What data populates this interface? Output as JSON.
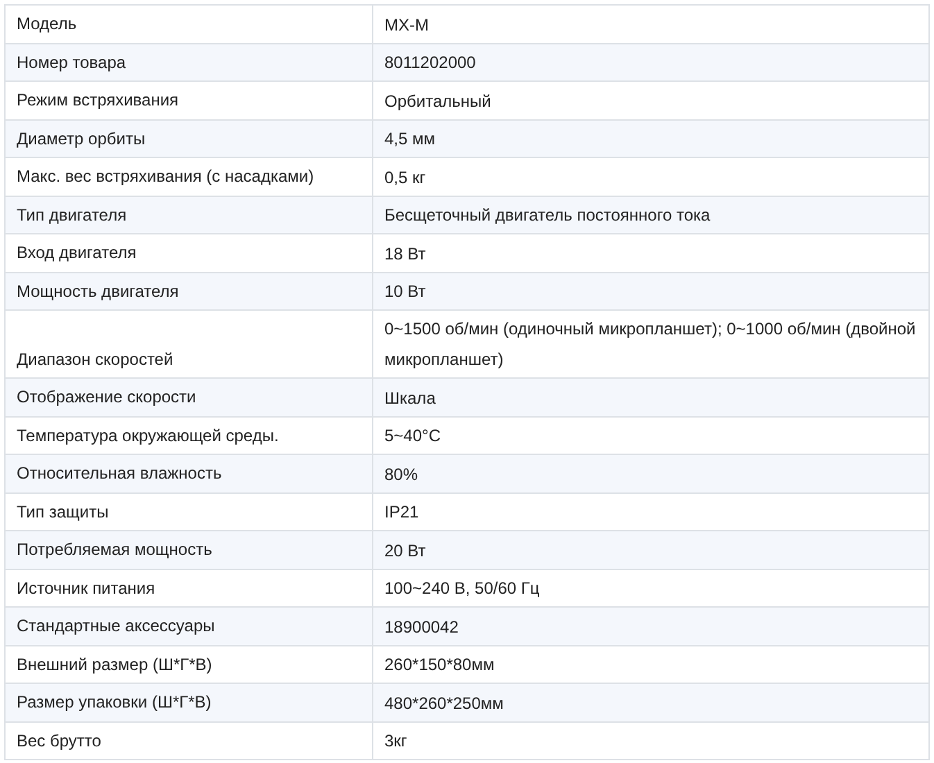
{
  "table": {
    "rows": [
      {
        "label": "Модель",
        "value": "MX-M"
      },
      {
        "label": "Номер товара",
        "value": "8011202000"
      },
      {
        "label": "Режим встряхивания",
        "value": "Орбитальный"
      },
      {
        "label": "Диаметр орбиты",
        "value": "4,5 мм"
      },
      {
        "label": "Макс. вес встряхивания (с насадками)",
        "value": "0,5 кг"
      },
      {
        "label": "Тип двигателя",
        "value": "Бесщеточный двигатель постоянного тока"
      },
      {
        "label": "Вход двигателя",
        "value": "18 Вт"
      },
      {
        "label": "Мощность двигателя",
        "value": "10 Вт"
      },
      {
        "label": "Диапазон скоростей",
        "value": "0~1500 об/мин (одиночный микропланшет); 0~1000 об/мин (двойной микропланшет)"
      },
      {
        "label": "Отображение скорости",
        "value": "Шкала"
      },
      {
        "label": "Температура окружающей среды.",
        "value": "5~40°C"
      },
      {
        "label": "Относительная влажность",
        "value": "80%"
      },
      {
        "label": "Тип защиты",
        "value": "IP21"
      },
      {
        "label": "Потребляемая мощность",
        "value": "20 Вт"
      },
      {
        "label": "Источник питания",
        "value": "100~240 В, 50/60 Гц"
      },
      {
        "label": "Стандартные аксессуары",
        "value": "18900042"
      },
      {
        "label": "Внешний размер (Ш*Г*В)",
        "value": "260*150*80мм"
      },
      {
        "label": "Размер упаковки (Ш*Г*В)",
        "value": "480*260*250мм"
      },
      {
        "label": "Вес брутто",
        "value": "3кг"
      }
    ]
  }
}
